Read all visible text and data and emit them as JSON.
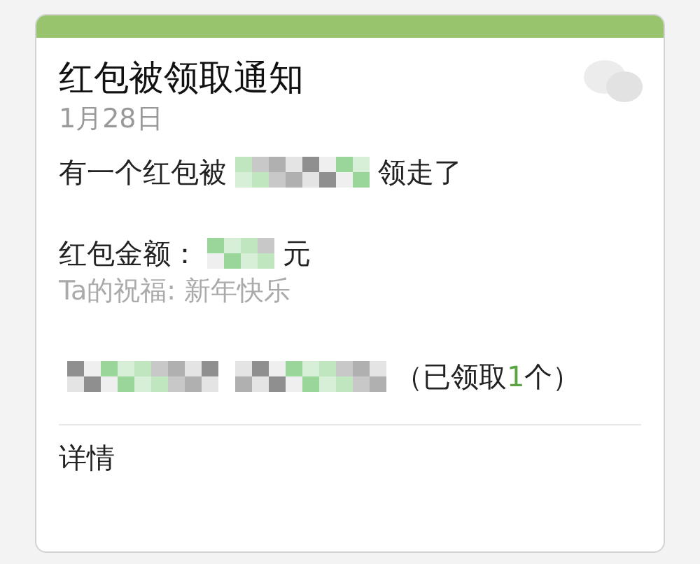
{
  "card": {
    "title": "红包被领取通知",
    "date": "1月28日",
    "taken_line": {
      "before": "有一个红包被",
      "after": "领走了"
    },
    "amount": {
      "label": "红包金额：",
      "unit": "元"
    },
    "blessing": "Ta的祝福: 新年快乐",
    "claimed": {
      "prefix": "（已领取",
      "count": "1",
      "suffix": "个）"
    },
    "footer_link": "详情"
  }
}
